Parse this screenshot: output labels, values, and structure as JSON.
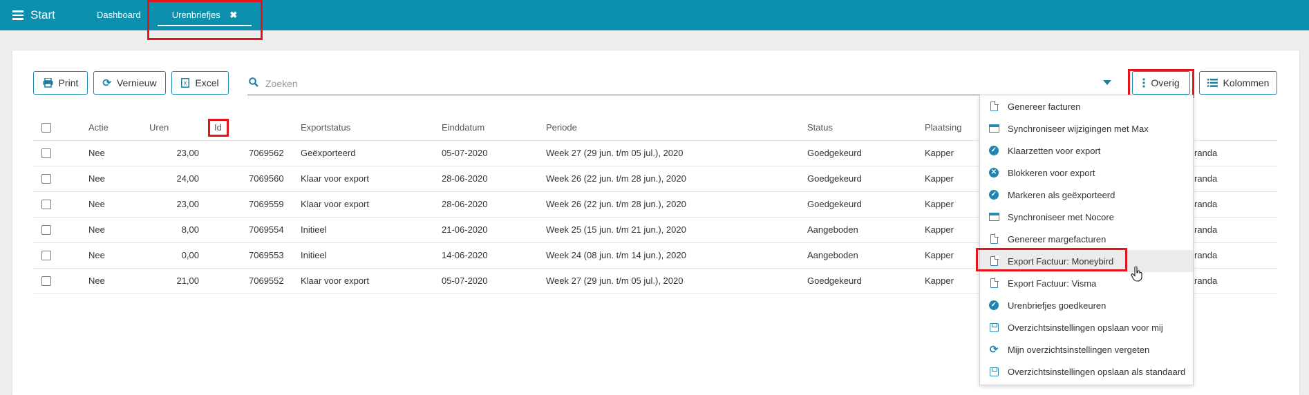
{
  "header": {
    "start_label": "Start",
    "tabs": [
      {
        "label": "Dashboard"
      },
      {
        "label": "Urenbriefjes",
        "close": "✖"
      }
    ]
  },
  "toolbar": {
    "print_label": "Print",
    "refresh_label": "Vernieuw",
    "excel_label": "Excel",
    "search_placeholder": "Zoeken",
    "overig_label": "Overig",
    "kolommen_label": "Kolommen"
  },
  "table": {
    "headers": [
      "Actie",
      "Uren",
      "Id",
      "Exportstatus",
      "Einddatum",
      "Periode",
      "Status",
      "Plaatsing"
    ],
    "rows": [
      {
        "actie": "Nee",
        "uren": "23,00",
        "id": "7069562",
        "exportstatus": "Geëxporteerd",
        "einddatum": "05-07-2020",
        "periode": "Week 27 (29 jun. t/m 05 jul.), 2020",
        "status": "Goedgekeurd",
        "plaatsing": "Kapper",
        "extra": "randa"
      },
      {
        "actie": "Nee",
        "uren": "24,00",
        "id": "7069560",
        "exportstatus": "Klaar voor export",
        "einddatum": "28-06-2020",
        "periode": "Week 26 (22 jun. t/m 28 jun.), 2020",
        "status": "Goedgekeurd",
        "plaatsing": "Kapper",
        "extra": "randa"
      },
      {
        "actie": "Nee",
        "uren": "23,00",
        "id": "7069559",
        "exportstatus": "Klaar voor export",
        "einddatum": "28-06-2020",
        "periode": "Week 26 (22 jun. t/m 28 jun.), 2020",
        "status": "Goedgekeurd",
        "plaatsing": "Kapper",
        "extra": "randa"
      },
      {
        "actie": "Nee",
        "uren": "8,00",
        "id": "7069554",
        "exportstatus": "Initieel",
        "einddatum": "21-06-2020",
        "periode": "Week 25 (15 jun. t/m 21 jun.), 2020",
        "status": "Aangeboden",
        "plaatsing": "Kapper",
        "extra": "randa"
      },
      {
        "actie": "Nee",
        "uren": "0,00",
        "id": "7069553",
        "exportstatus": "Initieel",
        "einddatum": "14-06-2020",
        "periode": "Week 24 (08 jun. t/m 14 jun.), 2020",
        "status": "Aangeboden",
        "plaatsing": "Kapper",
        "extra": "randa"
      },
      {
        "actie": "Nee",
        "uren": "21,00",
        "id": "7069552",
        "exportstatus": "Klaar voor export",
        "einddatum": "05-07-2020",
        "periode": "Week 27 (29 jun. t/m 05 jul.), 2020",
        "status": "Goedgekeurd",
        "plaatsing": "Kapper",
        "extra": "randa"
      }
    ]
  },
  "dropdown": {
    "items": [
      {
        "label": "Genereer facturen",
        "icon": "document-icon"
      },
      {
        "label": "Synchroniseer wijzigingen met Max",
        "icon": "table-icon"
      },
      {
        "label": "Klaarzetten voor export",
        "icon": "check-circle-icon"
      },
      {
        "label": "Blokkeren voor export",
        "icon": "x-circle-icon"
      },
      {
        "label": "Markeren als geëxporteerd",
        "icon": "check-circle-icon"
      },
      {
        "label": "Synchroniseer met Nocore",
        "icon": "table-icon"
      },
      {
        "label": "Genereer margefacturen",
        "icon": "document-icon"
      },
      {
        "label": "Export Factuur: Moneybird",
        "icon": "document-icon"
      },
      {
        "label": "Export Factuur: Visma",
        "icon": "document-icon"
      },
      {
        "label": "Urenbriefjes goedkeuren",
        "icon": "check-circle-icon"
      },
      {
        "label": "Overzichtsinstellingen opslaan voor mij",
        "icon": "save-icon"
      },
      {
        "label": "Mijn overzichtsinstellingen vergeten",
        "icon": "refresh-icon"
      },
      {
        "label": "Overzichtsinstellingen opslaan als standaard",
        "icon": "save-icon"
      }
    ]
  },
  "colors": {
    "topbar": "#0c90ad",
    "accent": "#1a7fa0",
    "highlight": "#e3141c"
  }
}
